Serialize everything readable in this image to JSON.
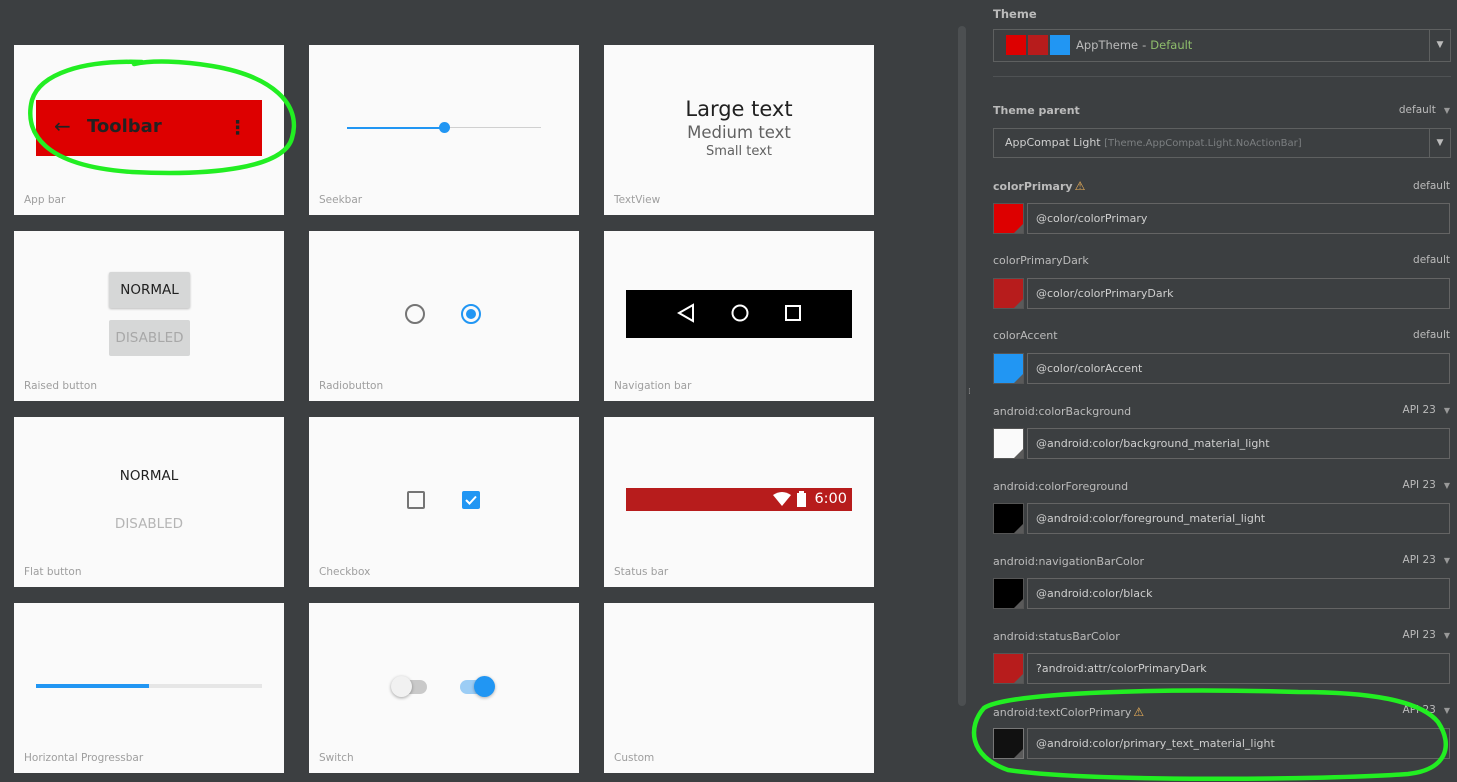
{
  "preview": {
    "cards": {
      "app_bar": {
        "label": "App bar",
        "toolbar_title": "Toolbar",
        "back_glyph": "←",
        "menu_glyph": "⋮"
      },
      "seekbar": {
        "label": "Seekbar",
        "progress": 0.5
      },
      "textview": {
        "label": "TextView",
        "large": "Large text",
        "medium": "Medium text",
        "small": "Small text"
      },
      "raised_button": {
        "label": "Raised button",
        "normal": "NORMAL",
        "disabled": "DISABLED"
      },
      "radiobutton": {
        "label": "Radiobutton"
      },
      "navigation_bar": {
        "label": "Navigation bar"
      },
      "flat_button": {
        "label": "Flat button",
        "normal": "NORMAL",
        "disabled": "DISABLED"
      },
      "checkbox": {
        "label": "Checkbox"
      },
      "status_bar": {
        "label": "Status bar",
        "time": "6:00"
      },
      "progressbar": {
        "label": "Horizontal Progressbar",
        "progress": 0.5
      },
      "switch": {
        "label": "Switch"
      },
      "custom": {
        "label": "Custom"
      }
    }
  },
  "theme_panel": {
    "title": "Theme",
    "theme_selector": {
      "name": "AppTheme",
      "separator": "-",
      "status": "Default",
      "swatches": [
        "#dd0000",
        "#b71c1c",
        "#2196f3"
      ]
    },
    "theme_parent": {
      "label": "Theme parent",
      "right": "default",
      "value_main": "AppCompat Light",
      "value_detail": "[Theme.AppCompat.Light.NoActionBar]"
    },
    "attributes": [
      {
        "name": "colorPrimary",
        "right": "default",
        "value": "@color/colorPrimary",
        "color": "#dd0000"
      },
      {
        "name": "colorPrimaryDark",
        "right": "default",
        "value": "@color/colorPrimaryDark",
        "color": "#b71c1c"
      },
      {
        "name": "colorAccent",
        "right": "default",
        "value": "@color/colorAccent",
        "color": "#2196f3"
      },
      {
        "name": "android:colorBackground",
        "right": "API 23",
        "value": "@android:color/background_material_light",
        "color": "#fafafa"
      },
      {
        "name": "android:colorForeground",
        "right": "API 23",
        "value": "@android:color/foreground_material_light",
        "color": "#000000"
      },
      {
        "name": "android:navigationBarColor",
        "right": "API 23",
        "value": "@android:color/black",
        "color": "#000000"
      },
      {
        "name": "android:statusBarColor",
        "right": "API 23",
        "value": "?android:attr/colorPrimaryDark",
        "color": "#b71c1c"
      },
      {
        "name": "android:textColorPrimary",
        "right": "API 23",
        "value": "@android:color/primary_text_material_light",
        "color": "#111111"
      }
    ]
  },
  "colors": {
    "accent": "#2196f3",
    "primary": "#dd0000",
    "primary_dark": "#b71c1c",
    "annotation": "#22ee22"
  }
}
